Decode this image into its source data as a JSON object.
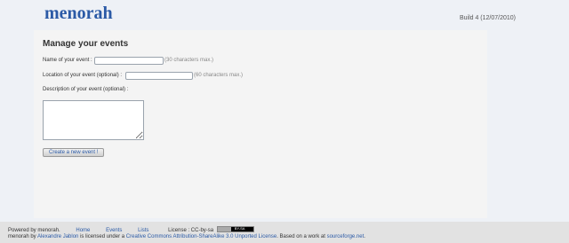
{
  "header": {
    "logo": "menorah",
    "build": "Build 4 (12/07/2010)"
  },
  "main": {
    "title": "Manage your events",
    "name_label": "Name of your event :",
    "name_value": "",
    "name_hint": "(30 characters max.)",
    "location_label": "Location of your event (optional) :",
    "location_value": "",
    "location_hint": "(60 characters max.)",
    "description_label": "Description of your event (optional) :",
    "description_value": "",
    "submit_label": "Create a new event !"
  },
  "footer": {
    "powered": "Powered by menorah.",
    "nav": [
      "Home",
      "Events",
      "Lists"
    ],
    "license_label": "License : CC-by-sa",
    "cc_badge_text": "BY-SA",
    "line2_prefix": "menorah by ",
    "author": "Alexandre Jablon",
    "line2_mid": " is licensed under a ",
    "license_name": "Creative Commons Attribution-ShareAlike 3.0 Unported License",
    "line2_suffix": ". Based on a work at ",
    "source_site": "sourceforge.net",
    "line2_end": "."
  }
}
